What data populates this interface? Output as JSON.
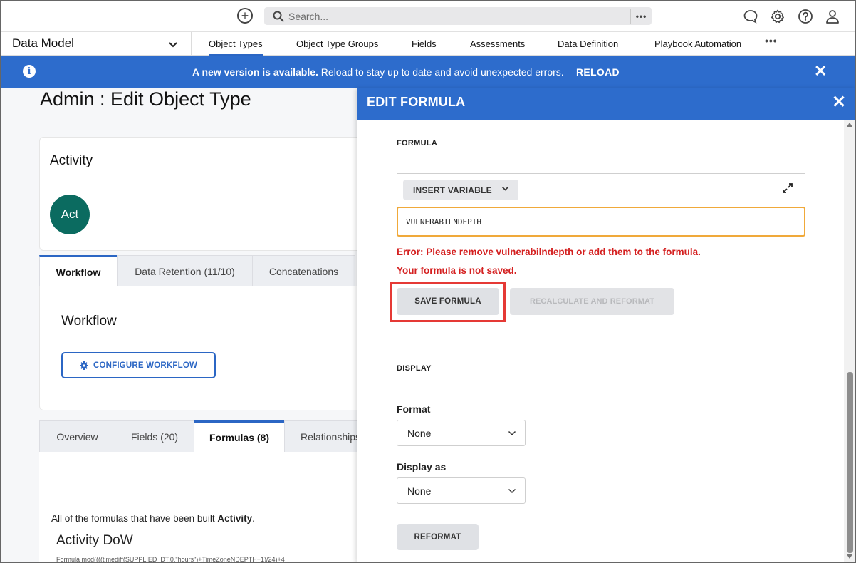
{
  "topbar": {
    "search_placeholder": "Search...",
    "icons": [
      "add-circle-icon",
      "search-icon",
      "more-icon",
      "chat-icon",
      "gear-icon",
      "help-icon",
      "user-icon"
    ]
  },
  "nav": {
    "model": "Data Model",
    "tabs": [
      {
        "label": "Object Types",
        "active": true
      },
      {
        "label": "Object Type Groups"
      },
      {
        "label": "Fields"
      },
      {
        "label": "Assessments"
      },
      {
        "label": "Data Definition"
      },
      {
        "label": "Playbook Automation"
      }
    ],
    "more": "•••"
  },
  "banner": {
    "bold": "A new version is available.",
    "text": " Reload to stay up to date and avoid unexpected errors.",
    "action": "RELOAD",
    "color": "#2d6ccc"
  },
  "page": {
    "title": "Admin : Edit Object Type",
    "card_title": "Activity",
    "avatar": "Act",
    "workflow_tabs": [
      "Workflow",
      "Data Retention (11/10)",
      "Concatenations"
    ],
    "workflow_title": "Workflow",
    "configure_label": "CONFIGURE WORKFLOW",
    "bottom_tabs": [
      "Overview",
      "Fields (20)",
      "Formulas (8)",
      "Relationships"
    ],
    "formulas_desc_prefix": "All of the formulas that have been built ",
    "formulas_desc_bold": "Activity",
    "formulas_desc_suffix": ".",
    "formula_name": "Activity DoW",
    "formula_snippet": "Formula mod((((timediff(SUPPLIED_DT,0,\"hours\")+TimeZoneNDEPTH+1)/24)+4"
  },
  "panel": {
    "title": "EDIT FORMULA",
    "formula_section": "FORMULA",
    "insert_variable": "INSERT VARIABLE",
    "formula_value": "VULNERABILNDEPTH",
    "error_1": "Error: Please remove vulnerabilndepth or add them to the formula.",
    "error_2": "Your formula is not saved.",
    "save_label": "SAVE FORMULA",
    "recalc_label": "RECALCULATE AND REFORMAT",
    "display_section": "DISPLAY",
    "format_label": "Format",
    "format_value": "None",
    "display_as_label": "Display as",
    "display_as_value": "None",
    "reformat_label": "REFORMAT",
    "error_color": "#d42020",
    "highlight_color": "#e53935"
  }
}
